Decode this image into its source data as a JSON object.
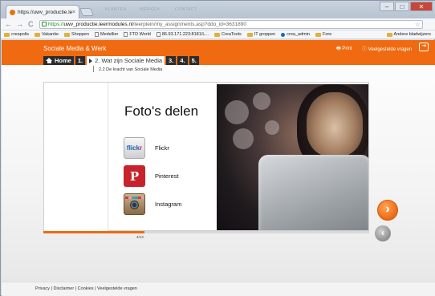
{
  "browser": {
    "tab_title": "https://uwv_productie.lee",
    "tab_close": "×",
    "ghost_tabs": [
      "KLANTEN",
      "WERKEN",
      "CONTACT"
    ],
    "url_https": "https://",
    "url_host": "uwv_productie.leermodules.nl",
    "url_path": "/leerplein/my_assignments.asp?ddo_id=3631890",
    "window_buttons": [
      "–",
      "□",
      "✕"
    ],
    "nav": {
      "back": "←",
      "forward": "→",
      "reload": "C"
    },
    "star": "☆",
    "menu": "≡"
  },
  "bookmarks": [
    {
      "icon": "folder",
      "label": "creapolis"
    },
    {
      "icon": "folder",
      "label": "Vakantie"
    },
    {
      "icon": "folder",
      "label": "Shoppen"
    },
    {
      "icon": "page",
      "label": "Medellier"
    },
    {
      "icon": "page",
      "label": "FTD World"
    },
    {
      "icon": "page",
      "label": "86.93.171.223:8181/L..."
    },
    {
      "icon": "folder",
      "label": "CreaTools"
    },
    {
      "icon": "folder",
      "label": "IT groppen"
    },
    {
      "icon": "globe",
      "label": "crea_admin"
    },
    {
      "icon": "folder",
      "label": "Fore"
    }
  ],
  "bookmarks_other": "Andere bladwijzers",
  "site": {
    "title": "Sociale Media & Werk",
    "print": "Print",
    "faq": "Veelgestelde vragen",
    "exit_icon": "⇥",
    "nav": {
      "home": "Home",
      "items": [
        "1.",
        "2. Wat zijn Sociale Media",
        "3.",
        "4.",
        "5."
      ]
    },
    "subnav": "2.2 De kracht van Sociale Media",
    "slide": {
      "title": "Foto's delen",
      "services": [
        {
          "icon": "flickr-logo",
          "label": "Flickr"
        },
        {
          "icon": "pinterest-logo",
          "label": "Pinterest"
        },
        {
          "icon": "instagram-logo",
          "label": "Instagram"
        }
      ]
    },
    "progress_fraction": 0.31,
    "page_counter": "4/13",
    "footer": "Privacy | Disclaimer | Cookies | Veelgestelde vragen"
  },
  "colors": {
    "accent": "#ef6a10",
    "nav_dark": "#2b2b2b"
  }
}
